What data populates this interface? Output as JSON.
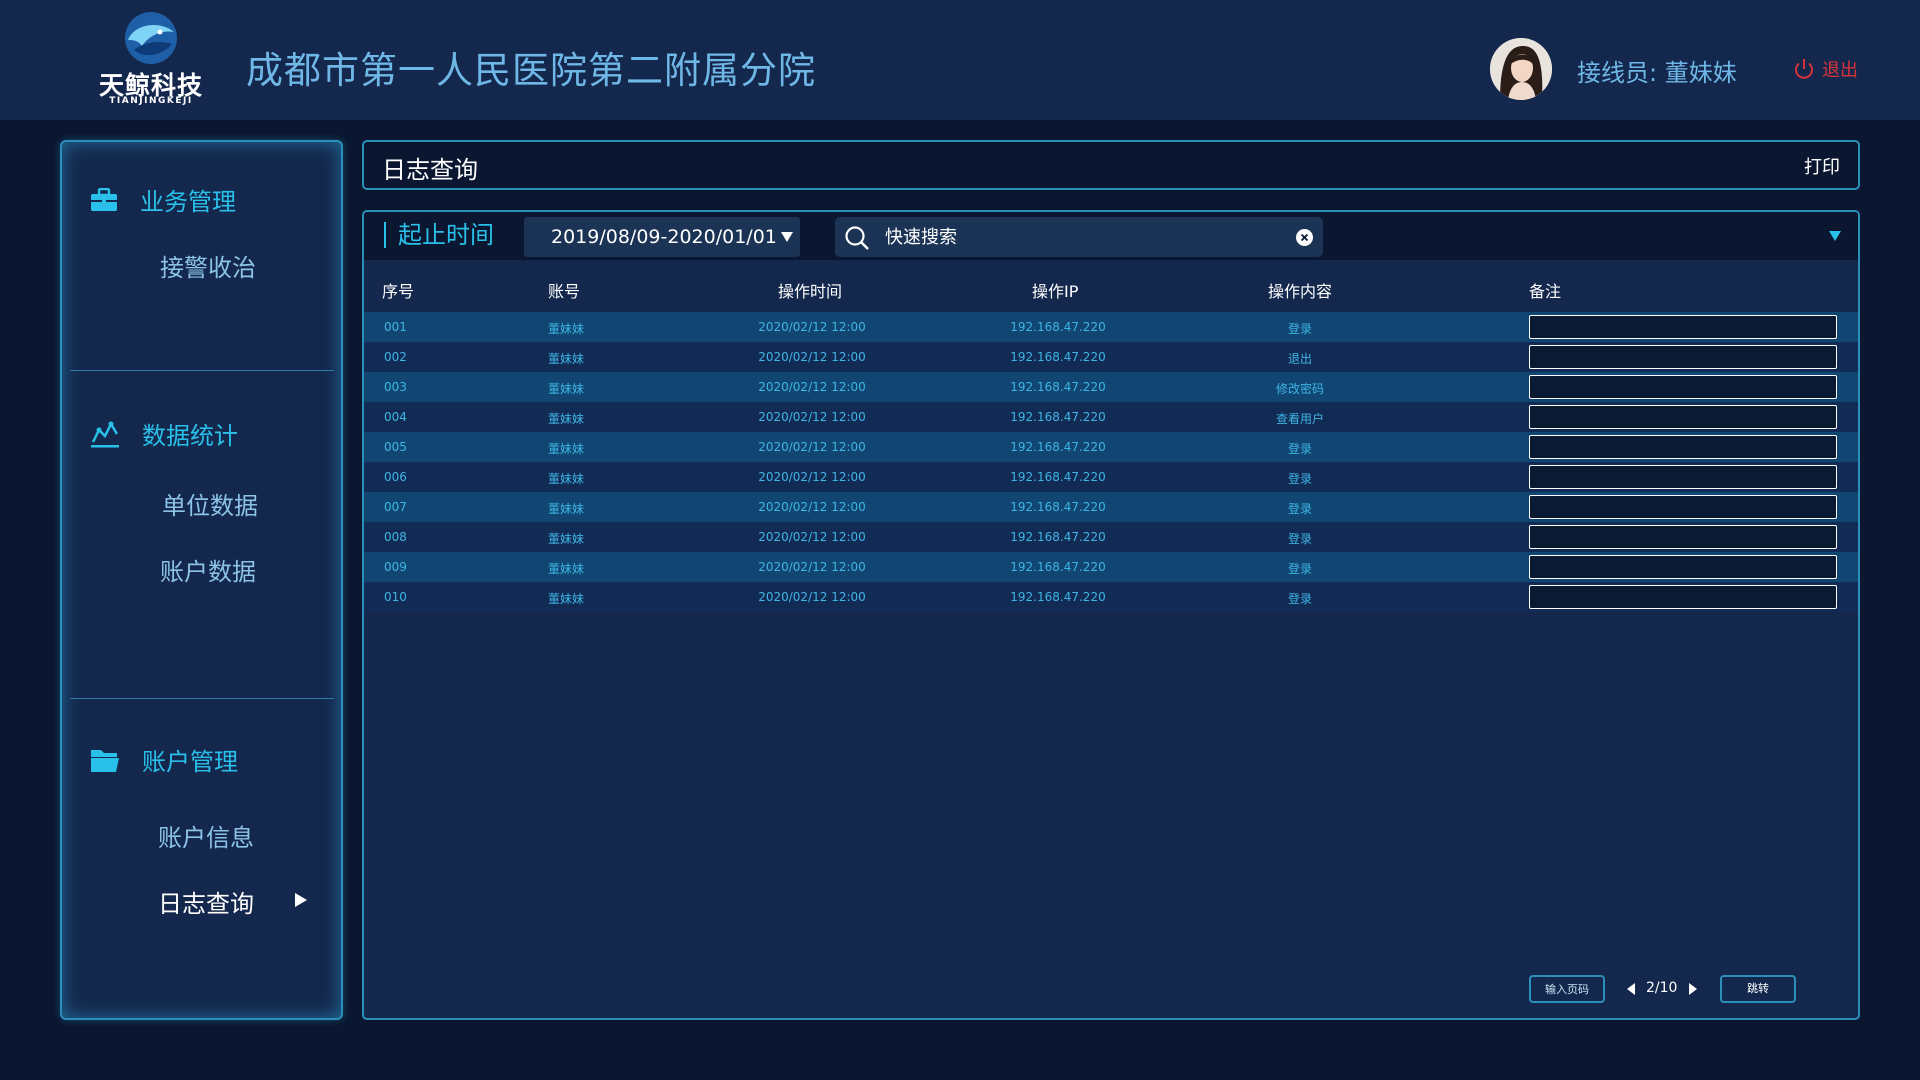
{
  "header": {
    "logo_cn": "天鲸科技",
    "logo_en": "TIANJINGKEJI",
    "title": "成都市第一人民医院第二附属分院",
    "operator_label": "接线员:",
    "operator_name": "董妹妹",
    "logout_label": "退出"
  },
  "sidebar": {
    "sections": [
      {
        "title": "业务管理",
        "icon": "briefcase-icon",
        "items": [
          "接警收治"
        ]
      },
      {
        "title": "数据统计",
        "icon": "chart-icon",
        "items": [
          "单位数据",
          "账户数据"
        ]
      },
      {
        "title": "账户管理",
        "icon": "folder-icon",
        "items": [
          "账户信息",
          "日志查询"
        ]
      }
    ],
    "active_item": "日志查询"
  },
  "panel": {
    "title": "日志查询",
    "print_label": "打印"
  },
  "filters": {
    "time_label": "起止时间",
    "date_range": "2019/08/09-2020/01/01",
    "search_placeholder": "快速搜索"
  },
  "table": {
    "columns": [
      "序号",
      "账号",
      "操作时间",
      "操作IP",
      "操作内容",
      "备注"
    ],
    "rows": [
      {
        "id": "001",
        "account": "董妹妹",
        "time": "2020/02/12 12:00",
        "ip": "192.168.47.220",
        "action": "登录"
      },
      {
        "id": "002",
        "account": "董妹妹",
        "time": "2020/02/12 12:00",
        "ip": "192.168.47.220",
        "action": "退出"
      },
      {
        "id": "003",
        "account": "董妹妹",
        "time": "2020/02/12 12:00",
        "ip": "192.168.47.220",
        "action": "修改密码"
      },
      {
        "id": "004",
        "account": "董妹妹",
        "time": "2020/02/12 12:00",
        "ip": "192.168.47.220",
        "action": "查看用户"
      },
      {
        "id": "005",
        "account": "董妹妹",
        "time": "2020/02/12 12:00",
        "ip": "192.168.47.220",
        "action": "登录"
      },
      {
        "id": "006",
        "account": "董妹妹",
        "time": "2020/02/12 12:00",
        "ip": "192.168.47.220",
        "action": "登录"
      },
      {
        "id": "007",
        "account": "董妹妹",
        "time": "2020/02/12 12:00",
        "ip": "192.168.47.220",
        "action": "登录"
      },
      {
        "id": "008",
        "account": "董妹妹",
        "time": "2020/02/12 12:00",
        "ip": "192.168.47.220",
        "action": "登录"
      },
      {
        "id": "009",
        "account": "董妹妹",
        "time": "2020/02/12 12:00",
        "ip": "192.168.47.220",
        "action": "登录"
      },
      {
        "id": "010",
        "account": "董妹妹",
        "time": "2020/02/12 12:00",
        "ip": "192.168.47.220",
        "action": "登录"
      }
    ]
  },
  "pagination": {
    "input_placeholder": "输入页码",
    "page_info": "2/10",
    "jump_label": "跳转"
  },
  "colors": {
    "background": "#0b1730",
    "panel": "#14284d",
    "accent": "#29c0ea",
    "border": "#2b8fb9",
    "logout": "#d9333a"
  }
}
